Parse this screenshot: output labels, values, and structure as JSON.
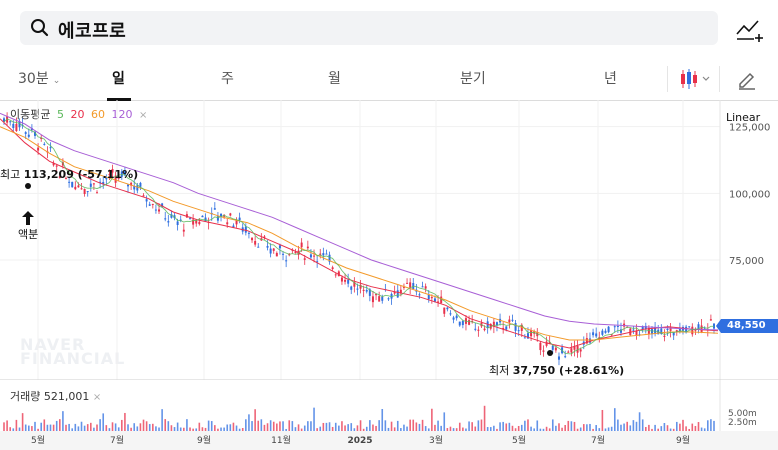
{
  "search": {
    "query": "에코프로"
  },
  "tabs": {
    "t30": "30분",
    "day": "일",
    "week": "주",
    "month": "월",
    "quarter": "분기",
    "year": "년"
  },
  "legend": {
    "title": "이동평균",
    "ma5": "5",
    "ma20": "20",
    "ma60": "60",
    "ma120": "120",
    "close": "×"
  },
  "scale": "Linear",
  "price_axis": [
    "125,000",
    "100,000",
    "75,000"
  ],
  "current_price": "48,550",
  "annotations": {
    "high_label": "최고",
    "high_value": "113,209 (-57.11%)",
    "low_label": "최저",
    "low_value": "37,750 (+28.61%)",
    "event": "액분"
  },
  "volume": {
    "label": "거래량",
    "value": "521,001",
    "close": "×",
    "axis": [
      "5.00m",
      "2.50m"
    ]
  },
  "x_axis": [
    "5월",
    "7월",
    "9월",
    "11월",
    "2025",
    "3월",
    "5월",
    "7월",
    "9월"
  ],
  "watermark": [
    "NAVER",
    "FINANCIAL"
  ],
  "colors": {
    "ma5": "#5cb85c",
    "ma20": "#e8304a",
    "ma60": "#f39a2a",
    "ma120": "#a85fd6",
    "up": "#e8304a",
    "down": "#2f6fe0",
    "badge": "#2f6fe0"
  },
  "chart_data": {
    "type": "line",
    "series": [
      {
        "name": "20",
        "values": [
          128000,
          119000,
          112000,
          108000,
          104000,
          101000,
          98000,
          93000,
          90000,
          88000,
          86000,
          82000,
          78000,
          73000,
          68000,
          65000,
          63000,
          61000,
          58000,
          53000,
          50000,
          47000,
          44000,
          42000,
          45000,
          47000,
          49000,
          50000,
          49000,
          48500
        ]
      },
      {
        "name": "60",
        "values": [
          125000,
          121000,
          115000,
          110000,
          107000,
          104000,
          101000,
          97000,
          94000,
          91000,
          89000,
          85000,
          80000,
          76000,
          72000,
          69000,
          66000,
          63000,
          60000,
          56000,
          53000,
          50000,
          47000,
          45000,
          45000,
          46000,
          47000,
          48000,
          48000,
          47500
        ]
      },
      {
        "name": "120",
        "values": [
          130000,
          126000,
          120000,
          116000,
          113000,
          110000,
          107000,
          104000,
          100000,
          97000,
          94000,
          91000,
          87000,
          83000,
          79000,
          75000,
          72000,
          69000,
          66000,
          63000,
          60000,
          57000,
          54000,
          52000,
          51000,
          50500,
          50000,
          49500,
          49000,
          48800
        ]
      }
    ],
    "ylim": [
      30000,
      135000
    ],
    "y_ticks": [
      125000,
      100000,
      75000
    ],
    "grid": true,
    "high": 113209,
    "low": 37750,
    "last": 48550
  }
}
